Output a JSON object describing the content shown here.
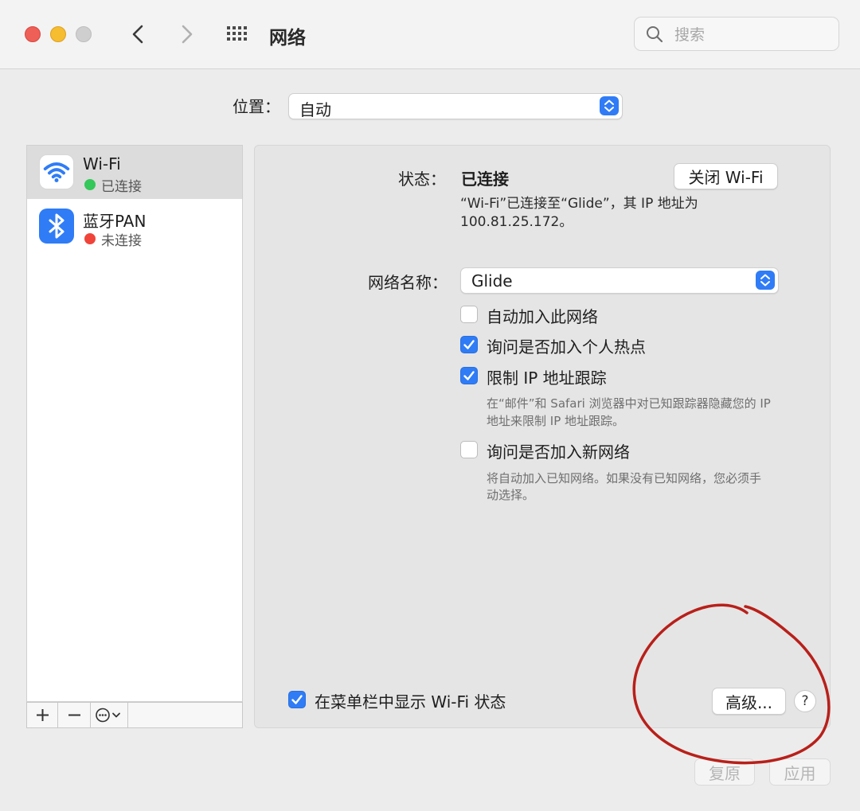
{
  "window": {
    "title": "网络",
    "search_placeholder": "搜索"
  },
  "icons": {
    "back": "chevron-left-icon",
    "forward": "chevron-right-icon",
    "grid": "grid-icon",
    "search": "search-icon",
    "wifi": "wifi-icon",
    "bluetooth": "bluetooth-icon"
  },
  "location": {
    "label": "位置：",
    "value": "自动"
  },
  "services": [
    {
      "name": "Wi-Fi",
      "status": "已连接",
      "status_color": "#34c759"
    },
    {
      "name": "蓝牙PAN",
      "status": "未连接",
      "status_color": "#f0443a"
    }
  ],
  "sidebar_tools": {
    "add": "+",
    "remove": "−"
  },
  "wifi_panel": {
    "status_label": "状态：",
    "status_value": "已连接",
    "turn_off_button": "关闭 Wi-Fi",
    "status_note_line1": "“Wi-Fi”已连接至“Glide”，其 IP 地址为",
    "status_note_line2": "100.81.25.172。",
    "network_name_label": "网络名称：",
    "network_name_value": "Glide",
    "options": [
      {
        "label": "自动加入此网络",
        "checked": false
      },
      {
        "label": "询问是否加入个人热点",
        "checked": true
      },
      {
        "label": "限制 IP 地址跟踪",
        "checked": true
      },
      {
        "label": "询问是否加入新网络",
        "checked": false
      }
    ],
    "limit_ip_note_line1": "在“邮件”和 Safari 浏览器中对已知跟踪器隐藏您的 IP",
    "limit_ip_note_line2": "地址来限制 IP 地址跟踪。",
    "new_network_note_line1": "将自动加入已知网络。如果没有已知网络，您必须手",
    "new_network_note_line2": "动选择。",
    "show_in_menubar": {
      "label": "在菜单栏中显示 Wi-Fi 状态",
      "checked": true
    },
    "advanced_button": "高级...",
    "help_button": "?"
  },
  "footer": {
    "revert_button": "复原",
    "apply_button": "应用"
  },
  "colors": {
    "accent": "#2f7cf6",
    "annotation": "#b8201a"
  }
}
